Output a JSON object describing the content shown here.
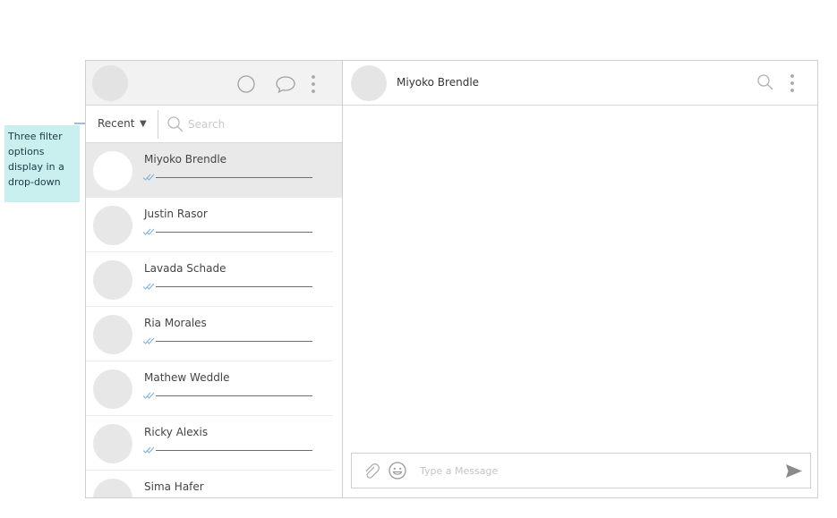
{
  "annotation": {
    "text": "Three filter options display in a drop-down"
  },
  "sidebar": {
    "filter": {
      "label": "Recent"
    },
    "search": {
      "placeholder": "Search"
    },
    "contacts": [
      {
        "name": "Miyoko Brendle",
        "active": true
      },
      {
        "name": "Justin Rasor"
      },
      {
        "name": "Lavada Schade"
      },
      {
        "name": "Ria Morales"
      },
      {
        "name": "Mathew Weddle"
      },
      {
        "name": "Ricky Alexis"
      },
      {
        "name": "Sima Hafer"
      }
    ]
  },
  "chat": {
    "header": {
      "name": "Miyoko Brendle"
    },
    "composer": {
      "placeholder": "Type a Message"
    }
  },
  "colors": {
    "annotation_bg": "#c9efef",
    "active_row_bg": "#e9e9e9",
    "read_check": "#7fb2e0"
  },
  "icons": {
    "left_header": [
      "status-icon",
      "new-chat-icon",
      "menu-dots-icon"
    ],
    "chat_header": [
      "search-icon",
      "menu-dots-icon"
    ],
    "composer": [
      "attach-icon",
      "emoji-icon",
      "send-icon"
    ],
    "contact_status": "read-check-icon"
  }
}
